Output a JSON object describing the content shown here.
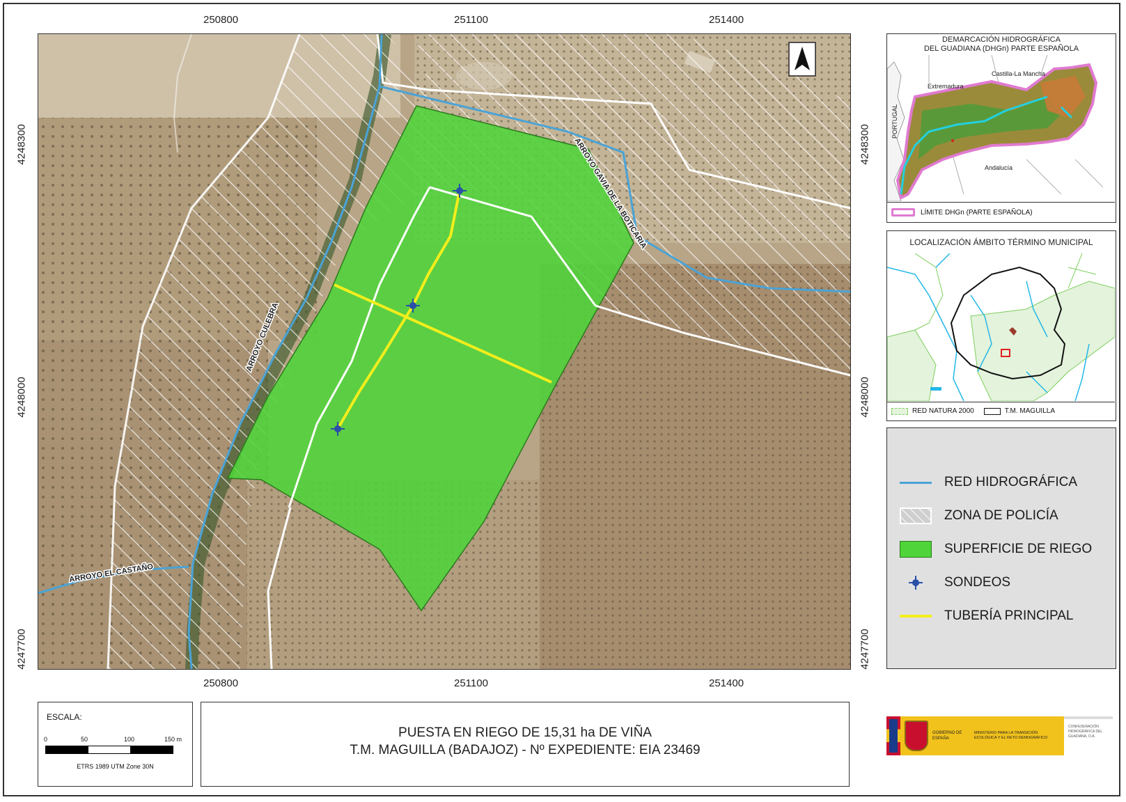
{
  "coords": {
    "x_top": [
      "250800",
      "251100",
      "251400"
    ],
    "x_bottom": [
      "250800",
      "251100",
      "251400"
    ],
    "y_left": [
      "4248300",
      "4248000",
      "4247700"
    ],
    "y_right": [
      "4248300",
      "4248000",
      "4247700"
    ]
  },
  "map_labels": {
    "arroyo_gavia": "ARROYO GAVIA DE LA BOTICARIA",
    "arroyo_culebra": "ARROYO CULEBRA",
    "arroyo_castano": "ARROYO EL CASTAÑO"
  },
  "inset_dhg": {
    "title_line1": "DEMARCACIÓN HIDROGRÁFICA",
    "title_line2": "DEL GUADIANA (DHGn) PARTE ESPAÑOLA",
    "label_extremadura": "Extremadura",
    "label_castilla": "Castilla-La Mancha",
    "label_andalucia": "Andalucía",
    "label_portugal": "PORTUGAL",
    "legend_label": "LÍMITE DHGn (PARTE ESPAÑOLA)"
  },
  "inset_tm": {
    "title": "LOCALIZACIÓN ÁMBITO TÉRMINO MUNICIPAL",
    "legend_natura": "RED NATURA 2000",
    "legend_tm": "T.M. MAGUILLA"
  },
  "legend": {
    "items": [
      {
        "label": "RED HIDROGRÁFICA",
        "icon": "blue-line-icon"
      },
      {
        "label": "ZONA DE POLICÍA",
        "icon": "hatch-box-icon"
      },
      {
        "label": "SUPERFICIE DE RIEGO",
        "icon": "green-box-icon"
      },
      {
        "label": "SONDEOS",
        "icon": "well-cross-icon"
      },
      {
        "label": "TUBERÍA PRINCIPAL",
        "icon": "yellow-line-icon"
      }
    ]
  },
  "scale": {
    "title": "ESCALA:",
    "ticks": [
      "0",
      "50",
      "100",
      "150 m"
    ],
    "projection": "ETRS 1989 UTM Zone 30N"
  },
  "title": {
    "line1": "PUESTA EN RIEGO DE 15,31 ha DE VIÑA",
    "line2": "T.M. MAGUILLA (BADAJOZ)  -  Nº EXPEDIENTE: EIA 23469"
  },
  "logos": {
    "gobierno": "GOBIERNO DE ESPAÑA",
    "ministerio": "MINISTERIO PARA LA TRANSICIÓN ECOLÓGICA Y EL RETO DEMOGRÁFICO",
    "confederacion": "CONFEDERACIÓN HIDROGRÁFICA DEL GUADIANA, O.A."
  },
  "colors": {
    "water": "#4aa3d6",
    "irrigation": "#4fd43a",
    "pipe": "#f2ee1c",
    "natura": "#7ccf5c",
    "dhg_limit": "#e07ad0"
  }
}
